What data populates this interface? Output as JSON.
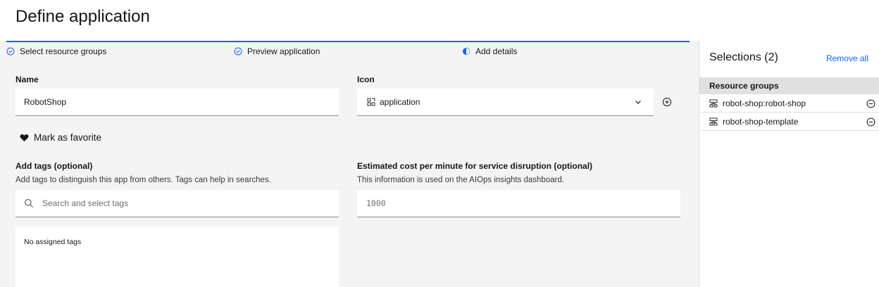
{
  "page": {
    "title": "Define application"
  },
  "steps": [
    {
      "label": "Select resource groups",
      "state": "complete"
    },
    {
      "label": "Preview application",
      "state": "complete"
    },
    {
      "label": "Add details",
      "state": "current"
    }
  ],
  "form": {
    "name": {
      "label": "Name",
      "value": "RobotShop"
    },
    "icon": {
      "label": "Icon",
      "value": "application",
      "icon": "application-icon"
    },
    "favorite": {
      "label": "Mark as favorite"
    },
    "tags": {
      "label": "Add tags (optional)",
      "helper": "Add tags to distinguish this app from others. Tags can help in searches.",
      "placeholder": "Search and select tags",
      "empty_text": "No assigned tags"
    },
    "cost": {
      "label": "Estimated cost per minute for service disruption (optional)",
      "helper": "This information is used on the AIOps insights dashboard.",
      "placeholder": "1000"
    }
  },
  "selections": {
    "title": "Selections (2)",
    "remove_all": "Remove all",
    "group_header": "Resource groups",
    "items": [
      {
        "label": "robot-shop:robot-shop"
      },
      {
        "label": "robot-shop-template"
      }
    ]
  },
  "colors": {
    "accent": "#0f62fe",
    "background": "#f4f4f4",
    "field": "#ffffff",
    "panel_header": "#e0e0e0"
  }
}
